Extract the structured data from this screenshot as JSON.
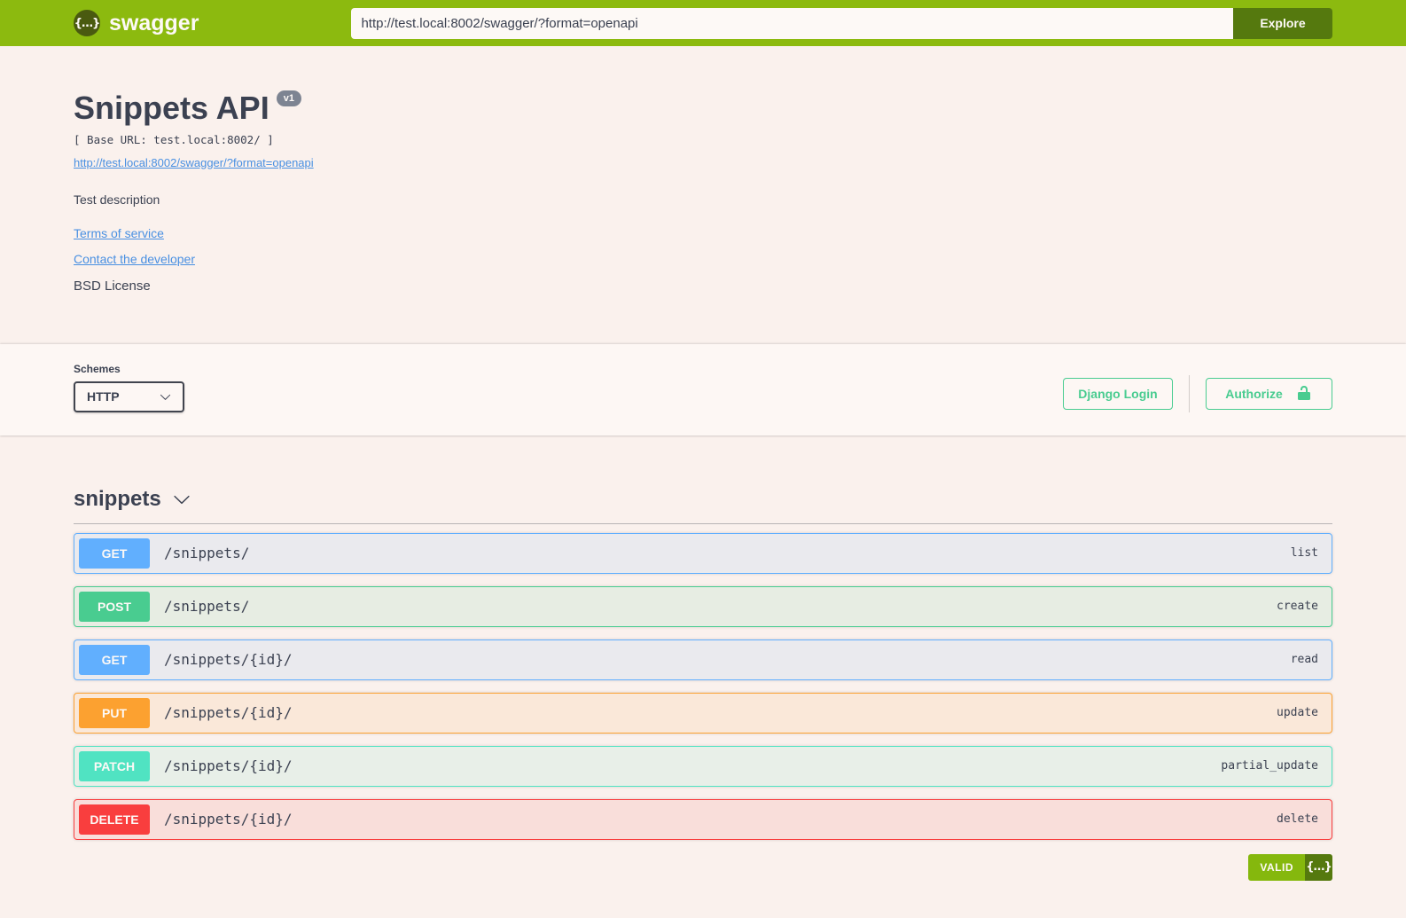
{
  "topbar": {
    "brand": "swagger",
    "url_value": "http://test.local:8002/swagger/?format=openapi",
    "explore_label": "Explore"
  },
  "info": {
    "title": "Snippets API",
    "version_badge": "v1",
    "base_url": "[ Base URL: test.local:8002/ ]",
    "spec_link": "http://test.local:8002/swagger/?format=openapi",
    "description": "Test description",
    "terms_label": "Terms of service",
    "contact_label": "Contact the developer",
    "license": "BSD License"
  },
  "schemes": {
    "label": "Schemes",
    "selected": "HTTP",
    "django_login_label": "Django Login",
    "authorize_label": "Authorize"
  },
  "tag": {
    "name": "snippets"
  },
  "operations": [
    {
      "method": "GET",
      "path": "/snippets/",
      "summary": "list"
    },
    {
      "method": "POST",
      "path": "/snippets/",
      "summary": "create"
    },
    {
      "method": "GET",
      "path": "/snippets/{id}/",
      "summary": "read"
    },
    {
      "method": "PUT",
      "path": "/snippets/{id}/",
      "summary": "update"
    },
    {
      "method": "PATCH",
      "path": "/snippets/{id}/",
      "summary": "partial_update"
    },
    {
      "method": "DELETE",
      "path": "/snippets/{id}/",
      "summary": "delete"
    }
  ],
  "validator": {
    "label": "VALID"
  },
  "icons": {
    "logo_glyph": "{…}",
    "validator_glyph": "{…}"
  },
  "colors": {
    "topbar_green": "#8cba0f",
    "explore_green": "#55790e",
    "link_blue": "#4990e2",
    "auth_green": "#49cc90",
    "get_blue": "#61affe",
    "post_green": "#49cc90",
    "put_orange": "#fca130",
    "patch_teal": "#50e3c2",
    "delete_red": "#f93e3e",
    "text_dark": "#3b4151",
    "version_badge_gray": "#7d8492"
  }
}
